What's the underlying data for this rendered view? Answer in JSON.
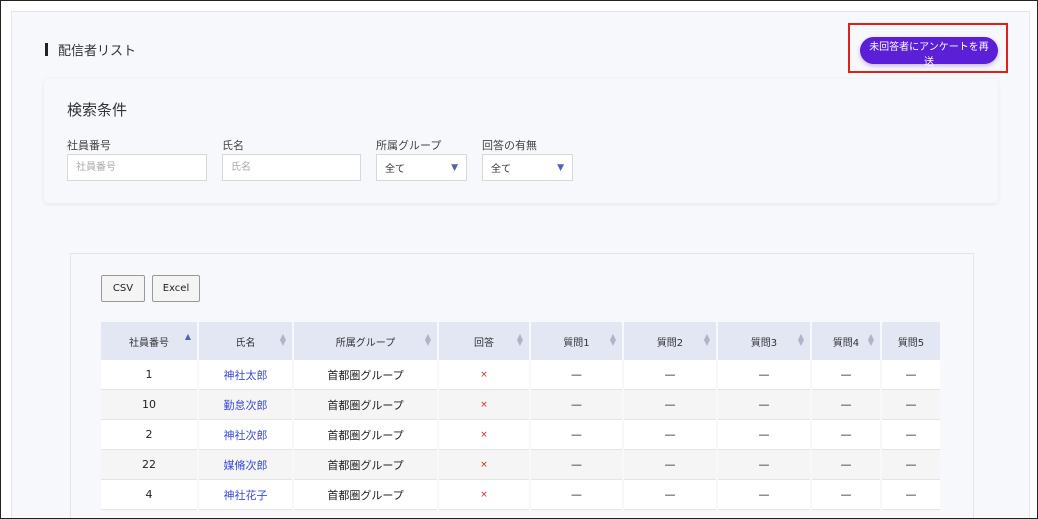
{
  "page": {
    "section_title": "配信者リスト",
    "resend_button": "未回答者にアンケートを再送"
  },
  "search": {
    "title": "検索条件",
    "fields": {
      "employee_no": {
        "label": "社員番号",
        "placeholder": "社員番号"
      },
      "name": {
        "label": "氏名",
        "placeholder": "氏名"
      },
      "group": {
        "label": "所属グループ",
        "value": "全て"
      },
      "answered": {
        "label": "回答の有無",
        "value": "全て"
      }
    }
  },
  "export": {
    "csv": "CSV",
    "excel": "Excel"
  },
  "table": {
    "headers": [
      "社員番号",
      "氏名",
      "所属グループ",
      "回答",
      "質問1",
      "質問2",
      "質問3",
      "質問4",
      "質問5"
    ],
    "rows": [
      {
        "no": "1",
        "name": "神社太郎",
        "group": "首都圏グループ",
        "answer": "×",
        "q1": "—",
        "q2": "—",
        "q3": "—",
        "q4": "—",
        "q5": "—"
      },
      {
        "no": "10",
        "name": "勤怠次郎",
        "group": "首都圏グループ",
        "answer": "×",
        "q1": "—",
        "q2": "—",
        "q3": "—",
        "q4": "—",
        "q5": "—"
      },
      {
        "no": "2",
        "name": "神社次郎",
        "group": "首都圏グループ",
        "answer": "×",
        "q1": "—",
        "q2": "—",
        "q3": "—",
        "q4": "—",
        "q5": "—"
      },
      {
        "no": "22",
        "name": "媒脩次郎",
        "group": "首都圏グループ",
        "answer": "×",
        "q1": "—",
        "q2": "—",
        "q3": "—",
        "q4": "—",
        "q5": "—"
      },
      {
        "no": "4",
        "name": "神社花子",
        "group": "首都圏グループ",
        "answer": "×",
        "q1": "—",
        "q2": "—",
        "q3": "—",
        "q4": "—",
        "q5": "—"
      }
    ]
  },
  "colors": {
    "accent": "#5a1fd6",
    "highlight_border": "#e0201b",
    "link": "#3a4bd6",
    "header_bg": "#e3e7f4"
  }
}
